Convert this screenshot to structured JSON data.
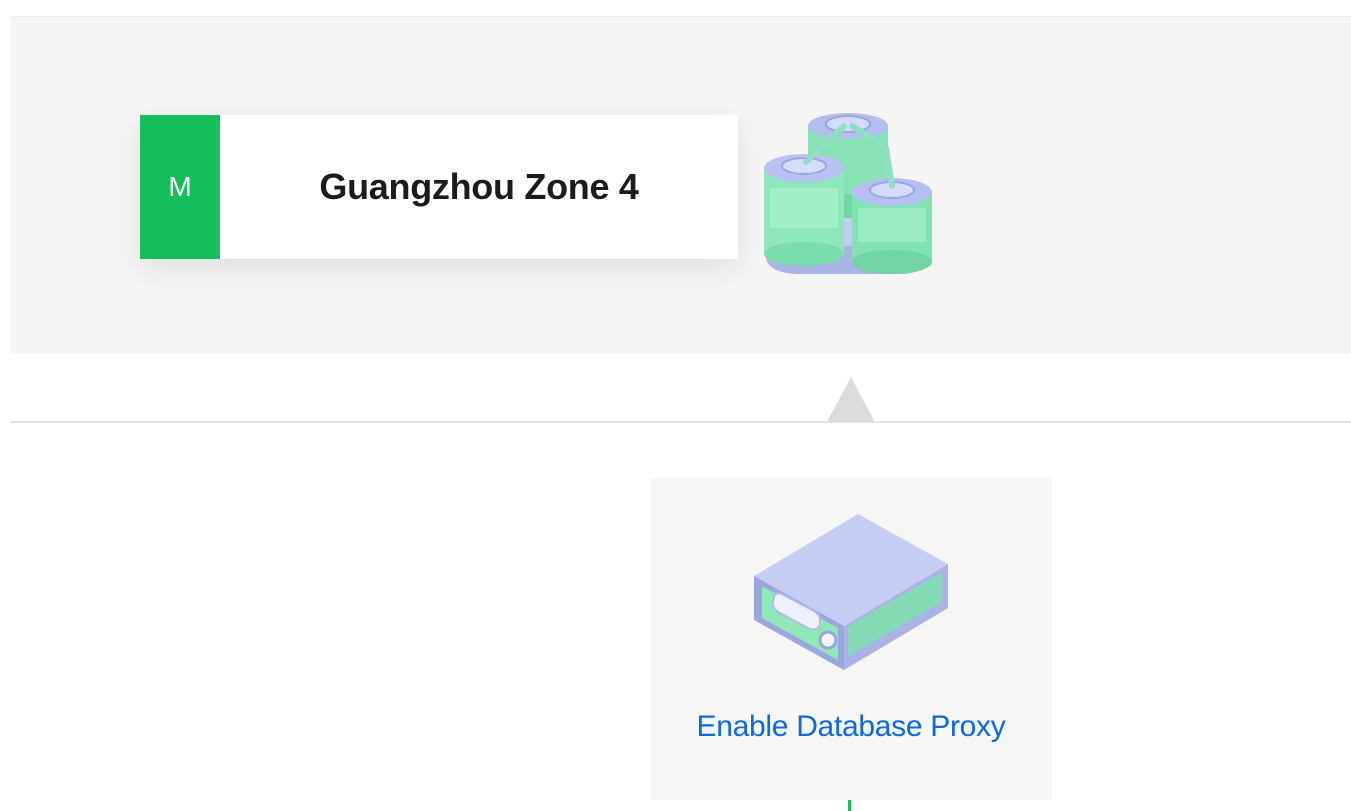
{
  "zone": {
    "badge": "M",
    "name": "Guangzhou Zone 4",
    "badge_color": "#14be5a",
    "icon": "database-cluster-icon"
  },
  "proxy": {
    "label": "Enable Database Proxy",
    "label_color": "#0e69e0",
    "icon": "proxy-server-icon"
  }
}
